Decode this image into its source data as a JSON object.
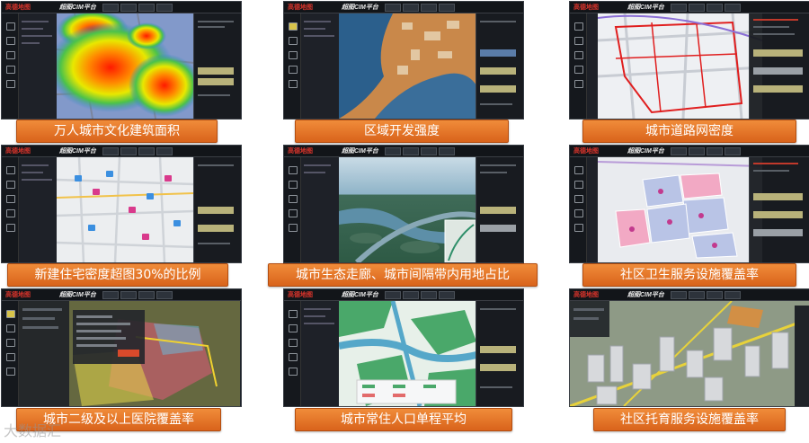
{
  "app": {
    "brand": "高德地图",
    "title": "超图CIM平台"
  },
  "panels": [
    {
      "caption": "万人城市文化建筑面积",
      "map": "heatmap"
    },
    {
      "caption": "区域开发强度",
      "map": "development"
    },
    {
      "caption": "城市道路网密度",
      "map": "road-network"
    },
    {
      "caption": "新建住宅密度超图30%的比例",
      "map": "residential-markers"
    },
    {
      "caption": "城市生态走廊、城市间隔带内用地占比",
      "map": "aerial-corridor"
    },
    {
      "caption": "社区卫生服务设施覆盖率",
      "map": "parcels"
    },
    {
      "caption": "城市二级及以上医院覆盖率",
      "map": "terrain"
    },
    {
      "caption": "城市常住人口单程平均",
      "map": "zoning"
    },
    {
      "caption": "社区托育服务设施覆盖率",
      "map": "3d-buildings"
    }
  ],
  "watermark": "大数据汇"
}
